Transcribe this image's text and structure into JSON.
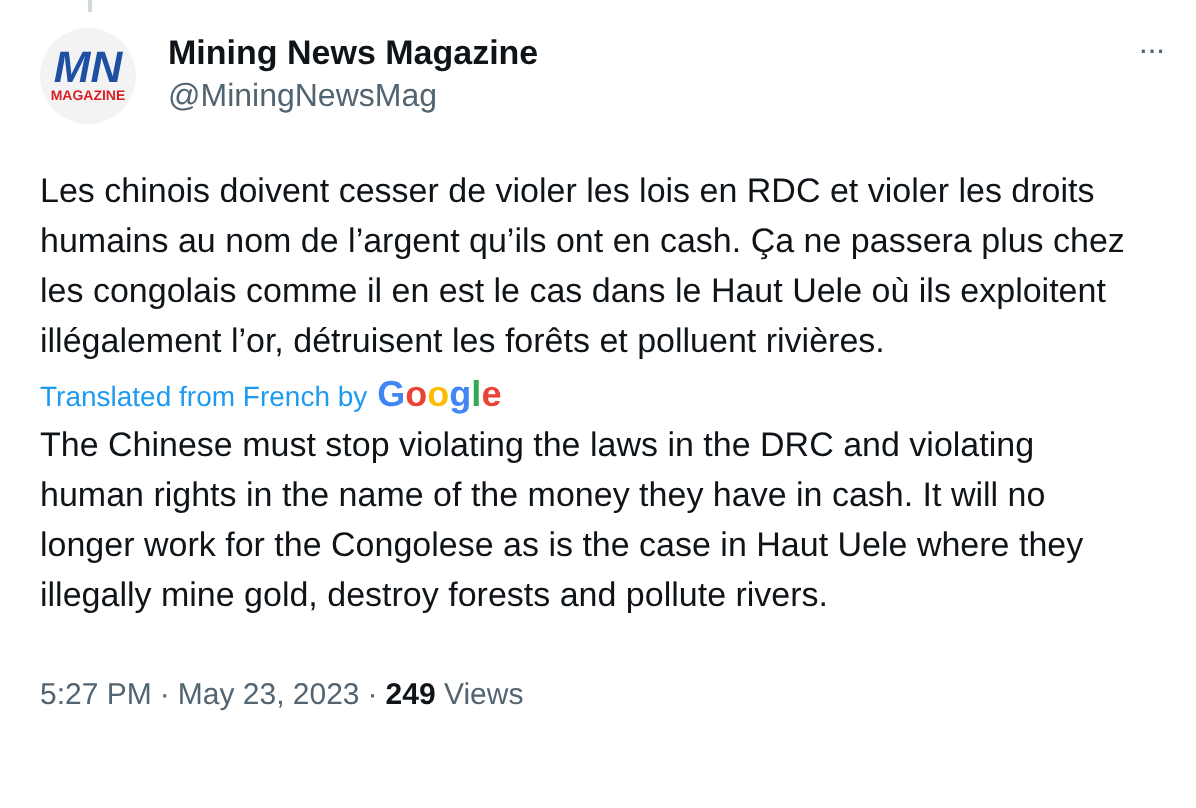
{
  "author": {
    "name": "Mining News Magazine",
    "handle": "@MiningNewsMag",
    "logo_letters": "MN",
    "logo_caption": "MAGAZINE"
  },
  "more_button": "···",
  "original_text": "Les chinois doivent cesser de violer les lois en RDC et violer les droits humains au nom de l’argent qu’ils ont en cash. Ça ne passera plus chez les congolais comme il en est le cas dans le Haut Uele où ils exploitent illégalement l’or, détruisent les forêts et polluent rivières.",
  "translation_note": {
    "label": "Translated from French by",
    "provider": "Google"
  },
  "translated_text": "The Chinese must stop violating the laws in the DRC and violating human rights in the name of the money they have in cash. It will no longer work for the Congolese as is the case in Haut Uele where they illegally mine gold, destroy forests and pollute rivers.",
  "meta": {
    "time": "5:27 PM",
    "date": "May 23, 2023",
    "separator": "·",
    "views_count": "249",
    "views_label": "Views"
  }
}
